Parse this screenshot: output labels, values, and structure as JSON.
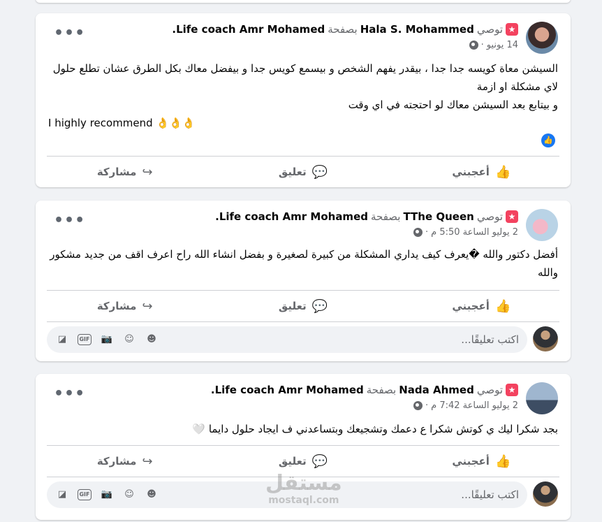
{
  "common": {
    "recommends": "توصي",
    "page_prefix": "بصفحة",
    "page_name": "Life coach Amr Mohamed.",
    "like": "أعجبني",
    "comment": "تعليق",
    "share": "مشاركة",
    "comment_placeholder": "اكتب تعليقًا...",
    "gif": "GIF",
    "more": "•••"
  },
  "posts": [
    {
      "author": "Hala S. Mohammed",
      "date": "14 يونيو",
      "lines": [
        "السيشن معاة كويسه جدا جدا ، بيقدر يفهم الشخص و بيسمع كويس جدا و بيفضل معاك بكل الطرق عشان تطلع حلول لاي مشكلة او ازمة",
        "و بيتابع بعد السيشن معاك لو احتجته في اي وقت"
      ],
      "en_line": "I highly recommend 👌👌👌"
    },
    {
      "author": "TThe Queen",
      "date": "2 يوليو الساعة 5:50 م",
      "lines": [
        "أفضل دكتور والله �يعرف كيف يداري المشكلة من كبيرة لصغيرة و بفضل انشاء الله راح اعرف اقف من جديد مشكور والله"
      ]
    },
    {
      "author": "Nada Ahmed",
      "date": "2 يوليو الساعة 7:42 م",
      "lines": [
        "بجد شكرا ليك ي كوتش شكرا ع دعمك وتشجيعك وبتساعدني ف ايجاد حلول دايما 🤍"
      ]
    }
  ],
  "watermark": {
    "main": "مستقل",
    "sub": "mostaql.com"
  },
  "colors": {
    "brand": "#1877f2",
    "recommend": "#f3425f",
    "background": "#f0f2f5"
  }
}
